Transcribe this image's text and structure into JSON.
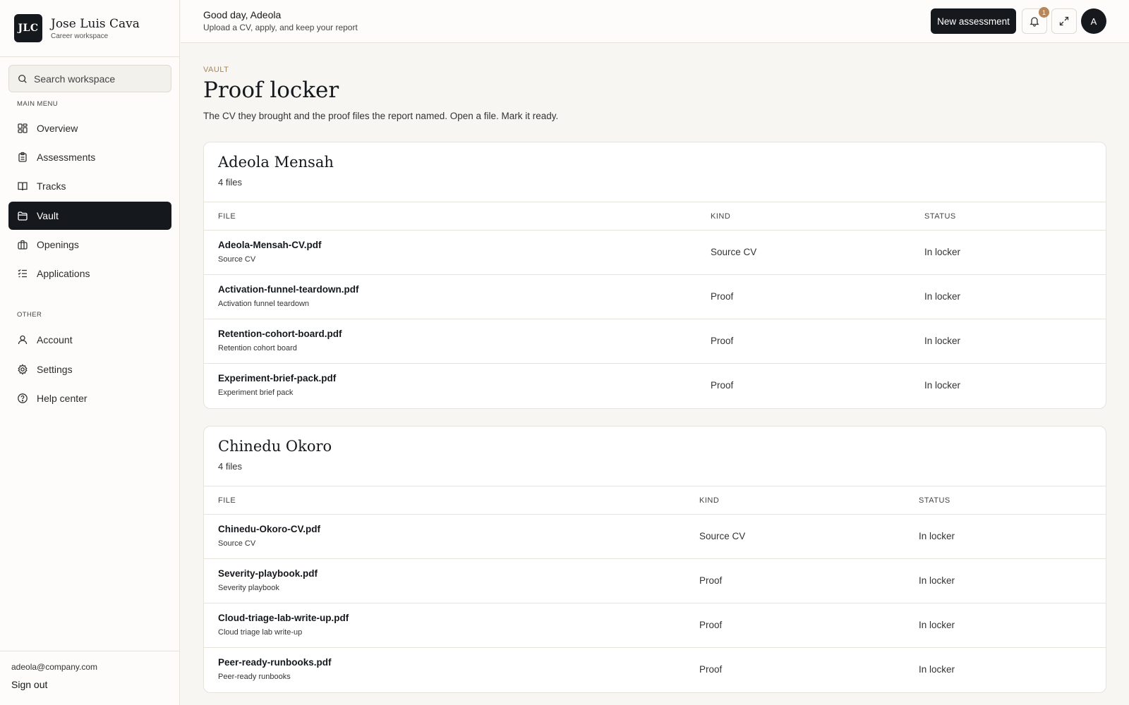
{
  "brand": {
    "logo": "JLC",
    "name": "Jose Luis Cava",
    "subtitle": "Career workspace"
  },
  "search": {
    "placeholder": "Search workspace"
  },
  "sidebar": {
    "main_label": "MAIN MENU",
    "main_items": [
      {
        "label": "Overview",
        "icon": "grid-icon"
      },
      {
        "label": "Assessments",
        "icon": "clipboard-icon"
      },
      {
        "label": "Tracks",
        "icon": "book-icon"
      },
      {
        "label": "Vault",
        "icon": "folder-icon",
        "active": true
      },
      {
        "label": "Openings",
        "icon": "briefcase-icon"
      },
      {
        "label": "Applications",
        "icon": "checklist-icon"
      }
    ],
    "other_label": "OTHER",
    "other_items": [
      {
        "label": "Account",
        "icon": "user-icon"
      },
      {
        "label": "Settings",
        "icon": "gear-icon"
      },
      {
        "label": "Help center",
        "icon": "help-icon"
      }
    ],
    "user_email": "adeola@company.com",
    "sign_out": "Sign out"
  },
  "header": {
    "greeting": "Good day, Adeola",
    "subtitle": "Upload a CV, apply, and keep your report",
    "new_button": "New assessment",
    "notification_count": "1",
    "avatar_initial": "A"
  },
  "page": {
    "eyebrow": "VAULT",
    "title": "Proof locker",
    "description": "The CV they brought and the proof files the report named. Open a file. Mark it ready."
  },
  "table_headers": {
    "file": "FILE",
    "kind": "KIND",
    "status": "STATUS"
  },
  "groups": [
    {
      "name": "Adeola Mensah",
      "count": "4 files",
      "files": [
        {
          "name": "Adeola-Mensah-CV.pdf",
          "sub": "Source CV",
          "kind": "Source CV",
          "status": "In locker"
        },
        {
          "name": "Activation-funnel-teardown.pdf",
          "sub": "Activation funnel teardown",
          "kind": "Proof",
          "status": "In locker"
        },
        {
          "name": "Retention-cohort-board.pdf",
          "sub": "Retention cohort board",
          "kind": "Proof",
          "status": "In locker"
        },
        {
          "name": "Experiment-brief-pack.pdf",
          "sub": "Experiment brief pack",
          "kind": "Proof",
          "status": "In locker"
        }
      ]
    },
    {
      "name": "Chinedu Okoro",
      "count": "4 files",
      "files": [
        {
          "name": "Chinedu-Okoro-CV.pdf",
          "sub": "Source CV",
          "kind": "Source CV",
          "status": "In locker"
        },
        {
          "name": "Severity-playbook.pdf",
          "sub": "Severity playbook",
          "kind": "Proof",
          "status": "In locker"
        },
        {
          "name": "Cloud-triage-lab-write-up.pdf",
          "sub": "Cloud triage lab write-up",
          "kind": "Proof",
          "status": "In locker"
        },
        {
          "name": "Peer-ready-runbooks.pdf",
          "sub": "Peer-ready runbooks",
          "kind": "Proof",
          "status": "In locker"
        }
      ]
    }
  ],
  "colors": {
    "dark": "#15181c",
    "accent": "#a88559",
    "badge": "#b8865a",
    "background": "#f7f6f3"
  }
}
